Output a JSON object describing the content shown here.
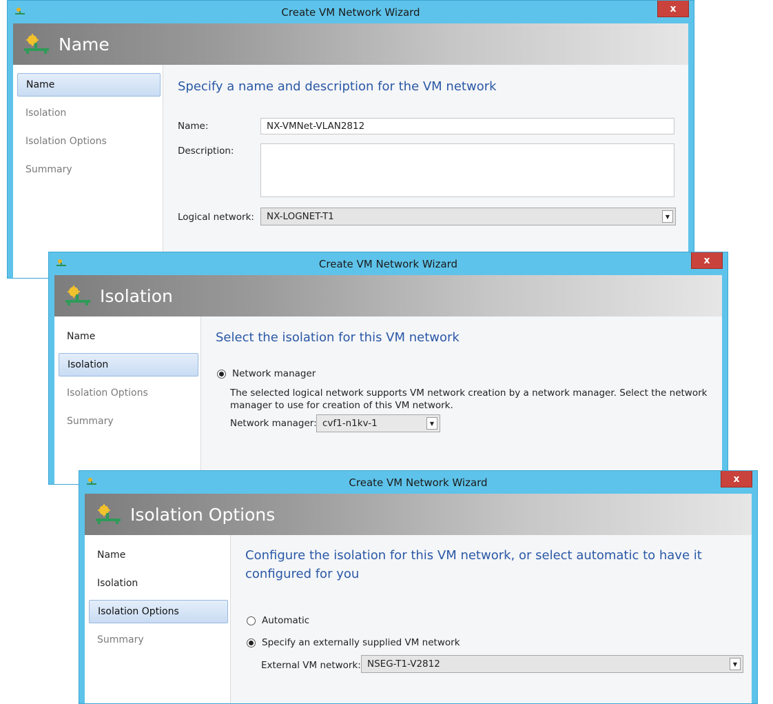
{
  "window_title": "Create VM Network Wizard",
  "close_glyph": "x",
  "nav_labels": {
    "name": "Name",
    "isolation": "Isolation",
    "isolation_options": "Isolation Options",
    "summary": "Summary"
  },
  "step_name": {
    "banner_title": "Name",
    "heading": "Specify a name and description for the VM network",
    "name_label": "Name:",
    "name_value": "NX-VMNet-VLAN2812",
    "description_label": "Description:",
    "description_value": "",
    "logical_network_label": "Logical network:",
    "logical_network_value": "NX-LOGNET-T1"
  },
  "step_isolation": {
    "banner_title": "Isolation",
    "heading": "Select the isolation for this VM network",
    "option_network_manager": "Network manager",
    "description_line1": "The selected logical network supports VM network creation by a network manager. Select the network",
    "description_line2": "manager to use for creation of this VM network.",
    "network_manager_label": "Network manager:",
    "network_manager_value": "cvf1-n1kv-1"
  },
  "step_isolation_options": {
    "banner_title": "Isolation Options",
    "heading_line1": "Configure the isolation for this VM network, or select automatic to have it",
    "heading_line2": "configured for you",
    "option_automatic": "Automatic",
    "option_external": "Specify an externally supplied VM network",
    "external_label": "External VM network:",
    "external_value": "NSEG-T1-V2812"
  },
  "figure_id": "298830",
  "colors": {
    "title_bar": "#5ec3ea",
    "close_button": "#c9423b",
    "heading_blue": "#2a58a6",
    "nav_active": "#c9dcf3"
  },
  "icons": {
    "app": "network-icon",
    "close": "close-icon",
    "dropdown": "chevron-down-icon"
  }
}
